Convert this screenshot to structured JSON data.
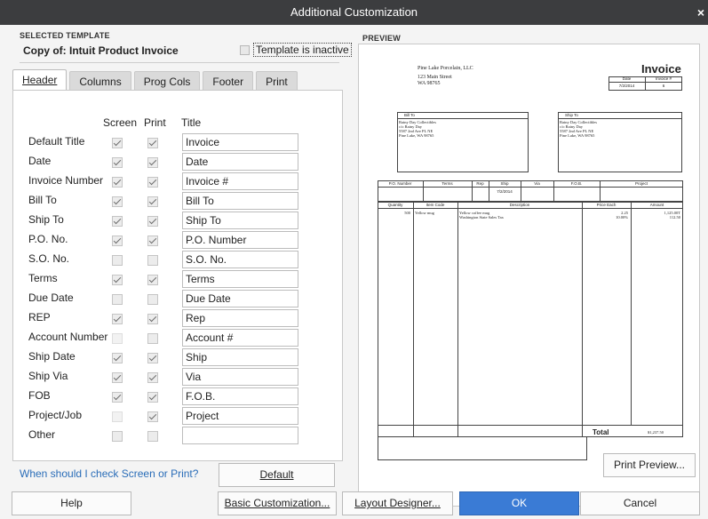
{
  "window": {
    "title": "Additional Customization",
    "close_glyph": "×"
  },
  "selected_template": {
    "group_label": "SELECTED TEMPLATE",
    "name": "Copy of: Intuit Product Invoice",
    "inactive_label": "Template is inactive",
    "inactive_checked": false
  },
  "tabs": [
    {
      "label": "Header",
      "active": true
    },
    {
      "label": "Columns",
      "active": false
    },
    {
      "label": "Prog Cols",
      "active": false
    },
    {
      "label": "Footer",
      "active": false
    },
    {
      "label": "Print",
      "active": false
    }
  ],
  "columns": {
    "screen": "Screen",
    "print": "Print",
    "title": "Title"
  },
  "fields": [
    {
      "label": "Default Title",
      "screen": "checked",
      "print": "checked",
      "title": "Invoice"
    },
    {
      "label": "Date",
      "screen": "checked",
      "print": "checked",
      "title": "Date"
    },
    {
      "label": "Invoice Number",
      "screen": "checked",
      "print": "checked",
      "title": "Invoice #"
    },
    {
      "label": "Bill To",
      "screen": "checked",
      "print": "checked",
      "title": "Bill To"
    },
    {
      "label": "Ship To",
      "screen": "checked",
      "print": "checked",
      "title": "Ship To"
    },
    {
      "label": "P.O. No.",
      "screen": "checked",
      "print": "checked",
      "title": "P.O. Number"
    },
    {
      "label": "S.O. No.",
      "screen": "unchecked",
      "print": "unchecked",
      "title": "S.O. No."
    },
    {
      "label": "Terms",
      "screen": "checked",
      "print": "checked",
      "title": "Terms"
    },
    {
      "label": "Due Date",
      "screen": "unchecked",
      "print": "unchecked",
      "title": "Due Date"
    },
    {
      "label": "REP",
      "screen": "checked",
      "print": "checked",
      "title": "Rep"
    },
    {
      "label": "Account Number",
      "screen": "disabled",
      "print": "unchecked",
      "title": "Account #"
    },
    {
      "label": "Ship Date",
      "screen": "checked",
      "print": "checked",
      "title": "Ship"
    },
    {
      "label": "Ship Via",
      "screen": "checked",
      "print": "checked",
      "title": "Via"
    },
    {
      "label": "FOB",
      "screen": "checked",
      "print": "checked",
      "title": "F.O.B."
    },
    {
      "label": "Project/Job",
      "screen": "disabled",
      "print": "checked",
      "title": "Project"
    },
    {
      "label": "Other",
      "screen": "unchecked",
      "print": "unchecked",
      "title": ""
    }
  ],
  "help_link": "When should I check Screen or Print?",
  "default_button": "Default",
  "preview": {
    "group_label": "PREVIEW",
    "print_preview_button": "Print Preview...",
    "company": {
      "name": "Pine Lake Porcelain, LLC",
      "address1": "123 Main Street",
      "address2": "WA 98765"
    },
    "doc_title": "Invoice",
    "header_cols": [
      "Date",
      "Invoice #"
    ],
    "header_vals": [
      "7/2/2014",
      "6"
    ],
    "bill_to_label": "Bill To",
    "ship_to_label": "Ship To",
    "bill_to_lines": [
      "Rainy Day Collectibles",
      "c/o Rainy Day",
      "5587 2nd Ave PL NE",
      "Pine Lake, WA 98765"
    ],
    "ship_to_lines": [
      "Rainy Day Collectibles",
      "c/o Rainy Day",
      "5587 2nd Ave PL NE",
      "Pine Lake, WA 98765"
    ],
    "mid_cols": [
      "P.O. Number",
      "Terms",
      "Rep",
      "Ship",
      "Via",
      "F.O.B.",
      "Project"
    ],
    "ship_val": "7/2/2014",
    "item_cols": [
      "Quantity",
      "Item Code",
      "Description",
      "Price Each",
      "Amount"
    ],
    "item_rows": [
      {
        "qty": "500",
        "code": "Yellow mug",
        "desc": "Yellow coffee mug",
        "price": "2.25",
        "amount": "1,125.00T"
      },
      {
        "qty": "",
        "code": "",
        "desc": "Washington State Sales Tax",
        "price": "10.00%",
        "amount": "112.50"
      }
    ],
    "total_label": "Total",
    "total_value": "$1,237.50"
  },
  "bottom_buttons": {
    "help": "Help",
    "basic": "Basic Customization...",
    "layout": "Layout Designer...",
    "ok": "OK",
    "cancel": "Cancel"
  }
}
